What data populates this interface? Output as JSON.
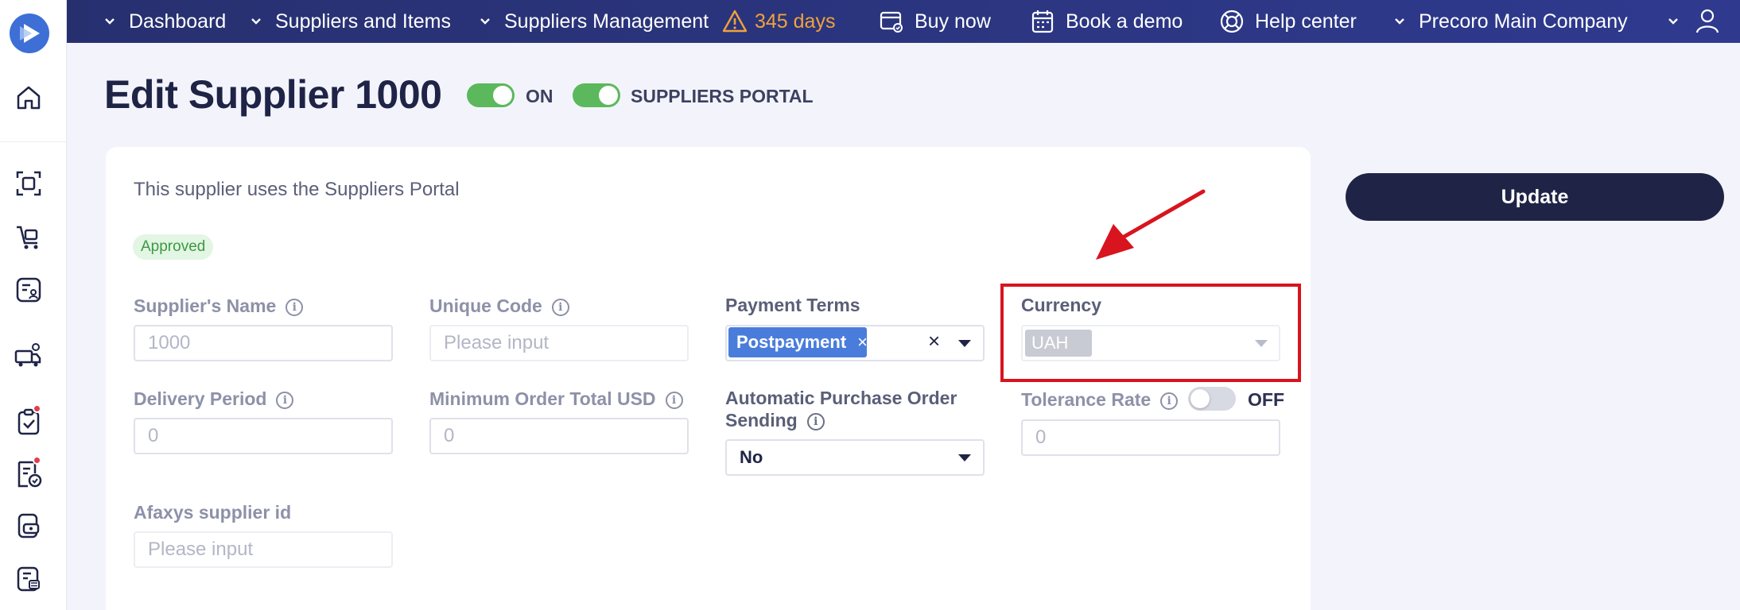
{
  "nav": {
    "dashboard": "Dashboard",
    "suppliers_items": "Suppliers and Items",
    "suppliers_management": "Suppliers Management",
    "trial_days": "345 days",
    "buy_now": "Buy now",
    "book_demo": "Book a demo",
    "help_center": "Help center",
    "company": "Precoro Main Company"
  },
  "page": {
    "title": "Edit Supplier 1000",
    "active_toggle_label": "ON",
    "portal_toggle_label": "SUPPLIERS PORTAL",
    "portal_note": "This supplier uses the Suppliers Portal",
    "status_badge": "Approved",
    "update_button": "Update"
  },
  "form": {
    "supplier_name": {
      "label": "Supplier's Name",
      "value": "1000"
    },
    "unique_code": {
      "label": "Unique Code",
      "placeholder": "Please input"
    },
    "payment_terms": {
      "label": "Payment Terms",
      "selected_tag": "Postpayment",
      "tag_remove": "×",
      "clear": "×"
    },
    "currency": {
      "label": "Currency",
      "value": "UAH"
    },
    "delivery_period": {
      "label": "Delivery Period",
      "value": "0"
    },
    "min_order_total": {
      "label": "Minimum Order Total USD",
      "value": "0"
    },
    "auto_po_sending": {
      "label_line1": "Automatic Purchase Order",
      "label_line2": "Sending",
      "value": "No"
    },
    "tolerance_rate": {
      "label": "Tolerance Rate",
      "toggle_label": "OFF",
      "value": "0"
    },
    "afaxys_id": {
      "label": "Afaxys supplier id",
      "placeholder": "Please input"
    }
  },
  "colors": {
    "topbar": "#2f3a8f",
    "accent_navy": "#1f2447",
    "toggle_on": "#5cb85c",
    "tag_blue": "#4a7ddb",
    "highlight_red": "#d8141e",
    "warning": "#f0a23b"
  },
  "icons": [
    "logo-icon",
    "home-icon",
    "scan-icon",
    "cart-icon",
    "contact-icon",
    "supplier-icon",
    "checklist-icon",
    "invoice-icon",
    "payment-icon",
    "receipt-icon",
    "warning-icon",
    "buy-icon",
    "calendar-icon",
    "lifebuoy-icon",
    "user-icon",
    "chevron-down-icon"
  ]
}
